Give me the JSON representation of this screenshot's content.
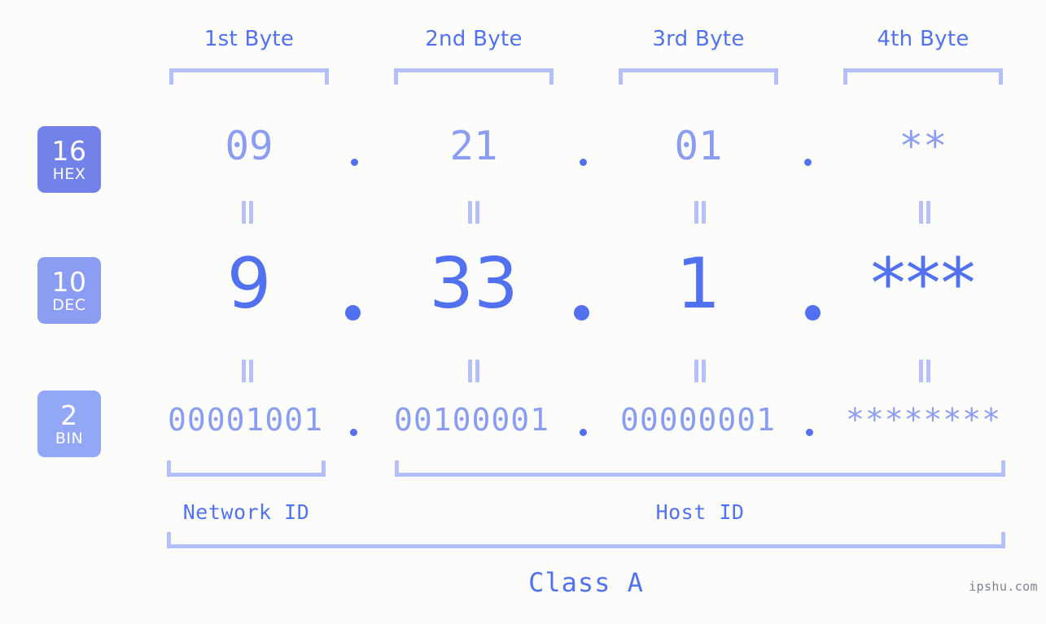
{
  "watermark": "ipshu.com",
  "byte_headers": [
    {
      "label": "1st Byte"
    },
    {
      "label": "2nd Byte"
    },
    {
      "label": "3rd Byte"
    },
    {
      "label": "4th Byte"
    }
  ],
  "radix_badges": [
    {
      "num": "16",
      "label": "HEX",
      "color": "#7382e8"
    },
    {
      "num": "10",
      "label": "DEC",
      "color": "#8b9cf3"
    },
    {
      "num": "2",
      "label": "BIN",
      "color": "#92a8f7"
    }
  ],
  "rows": {
    "hex": {
      "values": [
        "09",
        "21",
        "01",
        "**"
      ],
      "separator": "."
    },
    "dec": {
      "values": [
        "9",
        "33",
        "1",
        "***"
      ],
      "separator": "."
    },
    "bin": {
      "values": [
        "00001001",
        "00100001",
        "00000001",
        "********"
      ],
      "separator": "."
    }
  },
  "equals_marks": {
    "glyph": "||",
    "count_per_row": 4
  },
  "id_labels": [
    {
      "label": "Network ID"
    },
    {
      "label": "Host ID"
    }
  ],
  "class_label": "Class A",
  "colors": {
    "background": "#fcfdfa",
    "accent_strong": "#5271f0",
    "accent_mid": "#8b9cf3",
    "accent_light": "#b5bffa",
    "badge_hex": "#7382e8",
    "badge_dec": "#8b9cf3",
    "badge_bin": "#92a8f7",
    "watermark": "#7b8190"
  }
}
